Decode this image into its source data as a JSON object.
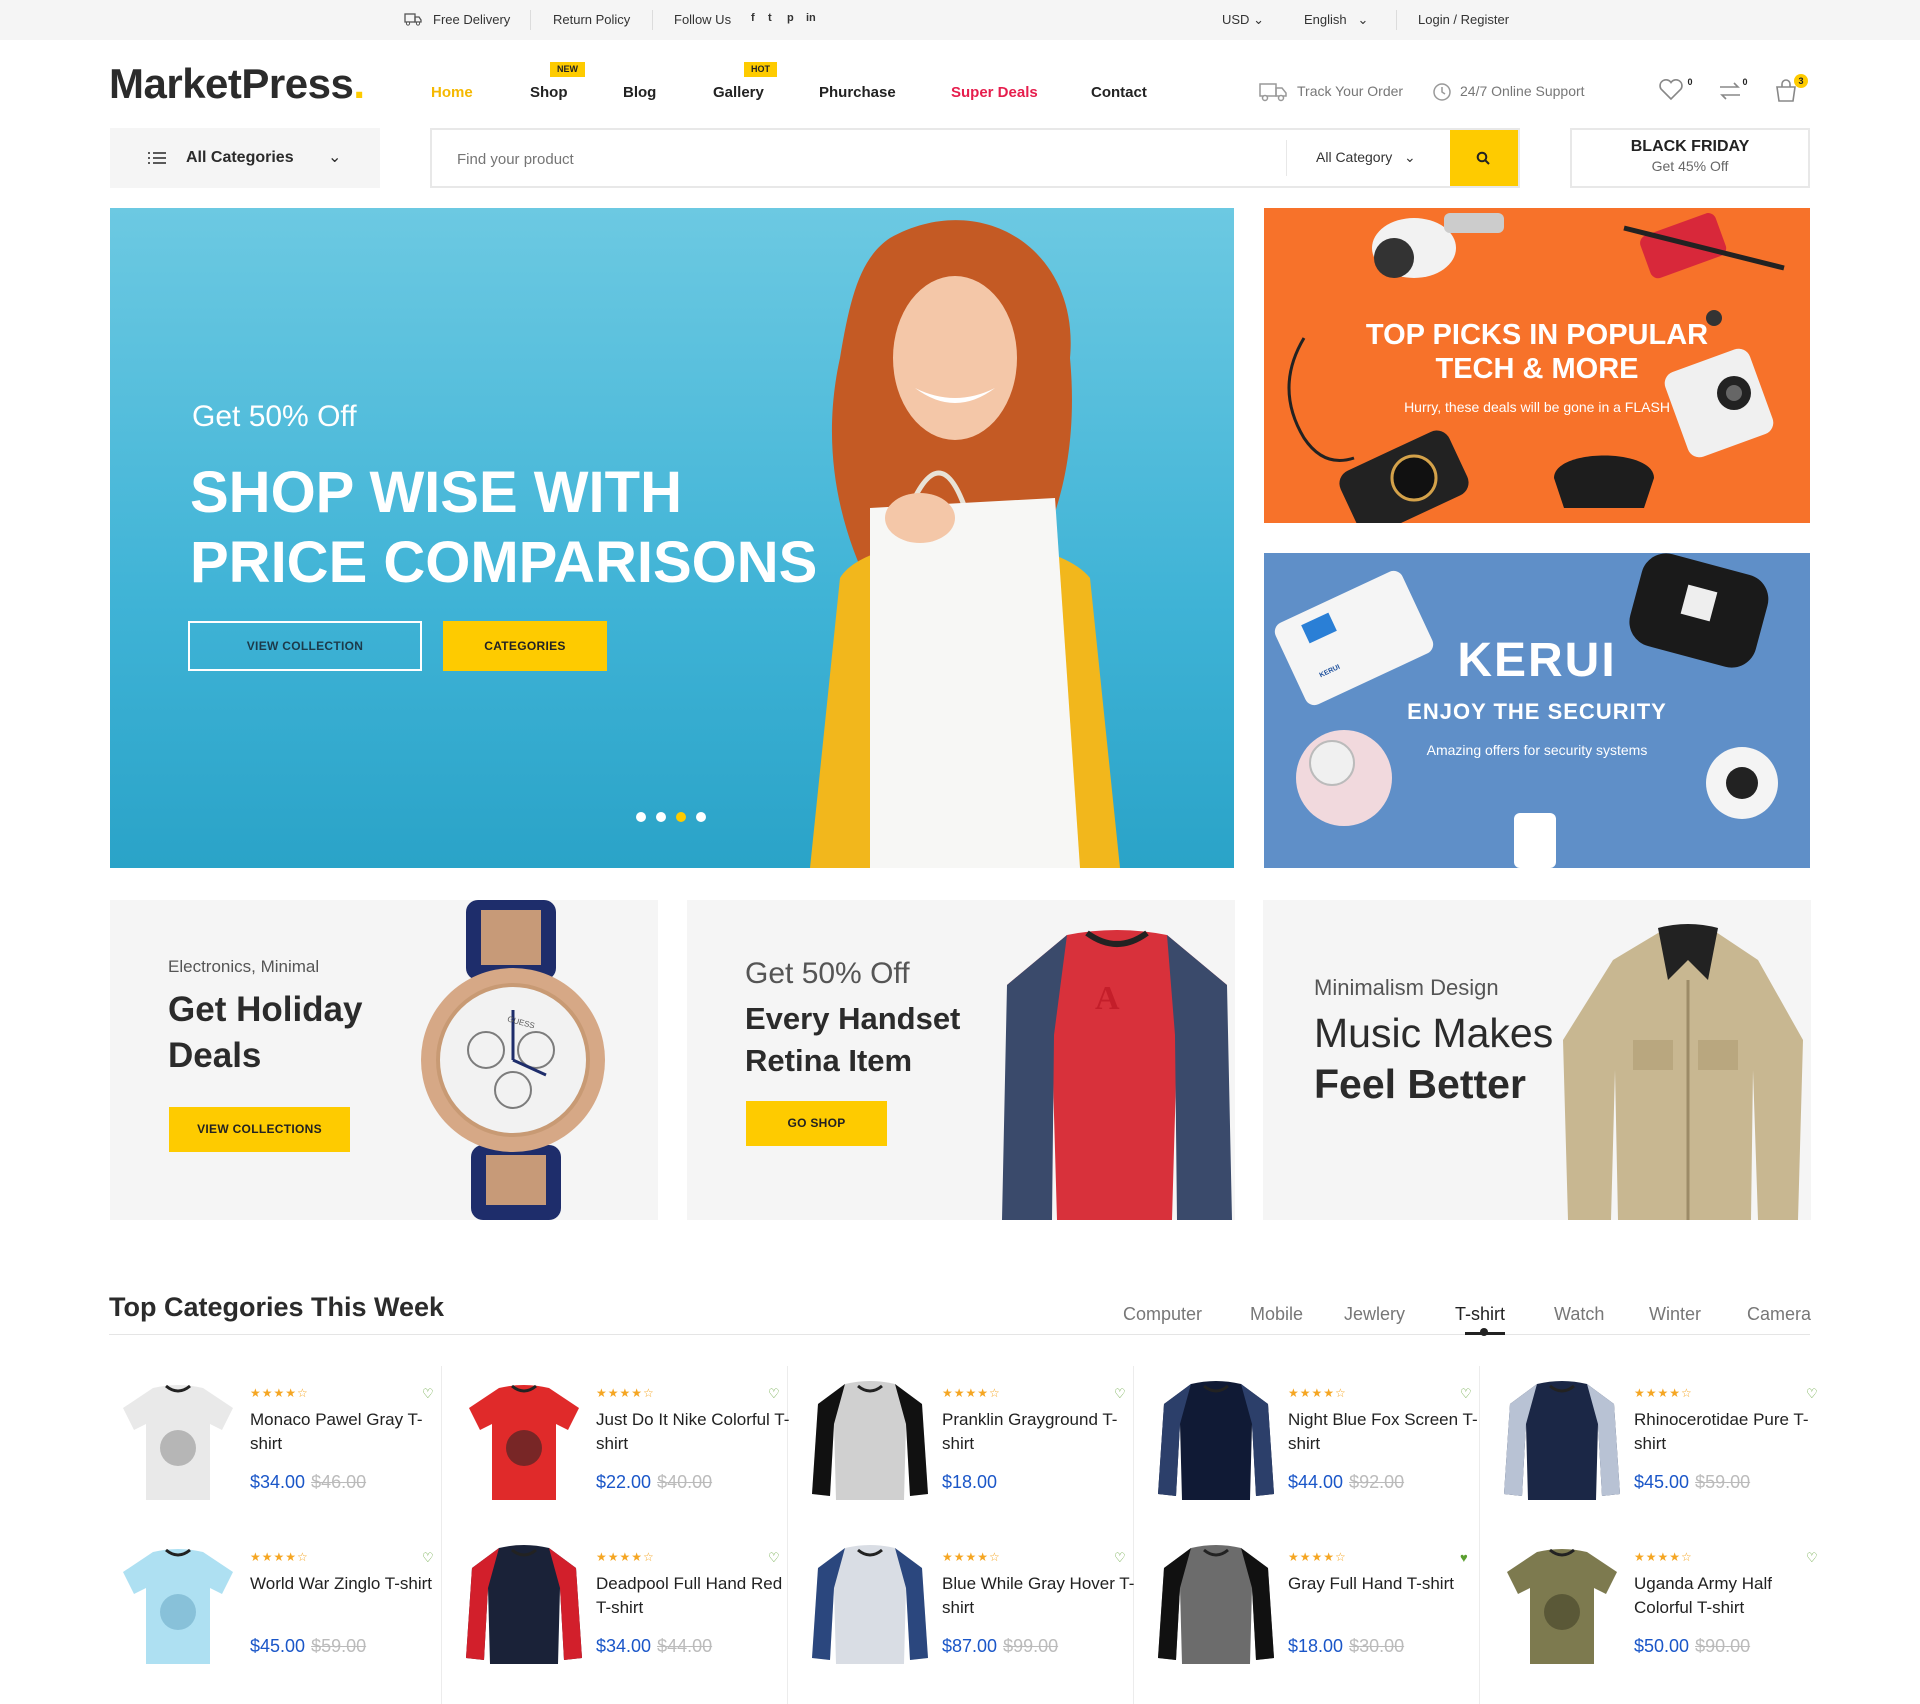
{
  "topbar": {
    "free_delivery": "Free Delivery",
    "return_policy": "Return Policy",
    "follow_us": "Follow Us",
    "social": [
      "f",
      "t",
      "p",
      "in"
    ],
    "currency": "USD",
    "language": "English",
    "login": "Login / Register"
  },
  "header": {
    "logo": "MarketPress",
    "nav": [
      "Home",
      "Shop",
      "Blog",
      "Gallery",
      "Phurchase",
      "Super Deals",
      "Contact"
    ],
    "tag_new": "NEW",
    "tag_hot": "HOT",
    "track_order": "Track Your Order",
    "support": "24/7 Online Support",
    "wishlist_count": "0",
    "compare_count": "0",
    "cart_count": "3",
    "accent_color": "#fecb00",
    "deals_color": "#e61e4d"
  },
  "searchbar": {
    "all_categories": "All Categories",
    "placeholder": "Find your product",
    "category_select": "All Category",
    "bf_title": "BLACK FRIDAY",
    "bf_sub": "Get 45% Off"
  },
  "hero": {
    "kicker": "Get 50% Off",
    "title_1": "SHOP WISE WITH",
    "title_2": "PRICE COMPARISONS",
    "btn_collection": "VIEW COLLECTION",
    "btn_categories": "CATEGORIES",
    "slide_count": 4,
    "active_slide": 3
  },
  "banner_tech": {
    "title_1": "TOP PICKS IN POPULAR",
    "title_2": "TECH & MORE",
    "sub": "Hurry, these deals will be gone in a FLASH"
  },
  "banner_kerui": {
    "brand": "KERUI",
    "title": "ENJOY THE SECURITY",
    "sub": "Amazing offers for security systems",
    "device_label": "KERUI"
  },
  "promos": [
    {
      "kicker": "Electronics, Minimal",
      "title_1": "Get Holiday",
      "title_2": "Deals",
      "button": "VIEW COLLECTIONS"
    },
    {
      "kicker": "Get 50% Off",
      "title_1": "Every Handset",
      "title_2": "Retina Item",
      "button": "GO SHOP"
    },
    {
      "kicker": "Minimalism Design",
      "title_1": "Music Makes",
      "title_2": "Feel Better"
    }
  ],
  "watch_brand": "GUESS",
  "tshirt_logo": "A",
  "section": {
    "title": "Top Categories This Week",
    "tabs": [
      "Computer",
      "Mobile",
      "Jewlery",
      "T-shirt",
      "Watch",
      "Winter",
      "Camera"
    ],
    "active_tab": "T-shirt"
  },
  "products": [
    {
      "name": "Monaco Pawel Gray T-shirt",
      "price": "$34.00",
      "old": "$46.00",
      "rating": 4,
      "wish": false
    },
    {
      "name": "Just Do It Nike Colorful T-shirt",
      "price": "$22.00",
      "old": "$40.00",
      "rating": 4,
      "wish": false
    },
    {
      "name": "Pranklin Grayground T-shirt",
      "price": "$18.00",
      "old": "",
      "rating": 4,
      "wish": false
    },
    {
      "name": "Night Blue Fox Screen T-shirt",
      "price": "$44.00",
      "old": "$92.00",
      "rating": 4,
      "wish": false
    },
    {
      "name": "Rhinocerotidae Pure T-shirt",
      "price": "$45.00",
      "old": "$59.00",
      "rating": 4,
      "wish": false
    },
    {
      "name": "World War Zinglo T-shirt",
      "price": "$45.00",
      "old": "$59.00",
      "rating": 4,
      "wish": false
    },
    {
      "name": "Deadpool Full Hand Red T-shirt",
      "price": "$34.00",
      "old": "$44.00",
      "rating": 4,
      "wish": false
    },
    {
      "name": "Blue While Gray Hover T-shirt",
      "price": "$87.00",
      "old": "$99.00",
      "rating": 4,
      "wish": false
    },
    {
      "name": "Gray Full Hand T-shirt",
      "price": "$18.00",
      "old": "$30.00",
      "rating": 4,
      "wish": true
    },
    {
      "name": "Uganda Army Half Colorful T-shirt",
      "price": "$50.00",
      "old": "$90.00",
      "rating": 4,
      "wish": false
    }
  ],
  "icons": [
    "truck-icon",
    "return-icon",
    "facebook-icon",
    "twitter-icon",
    "pinterest-icon",
    "linkedin-icon",
    "heart-icon",
    "compare-icon",
    "cart-icon",
    "menu-icon",
    "search-icon",
    "chevron-down-icon"
  ]
}
